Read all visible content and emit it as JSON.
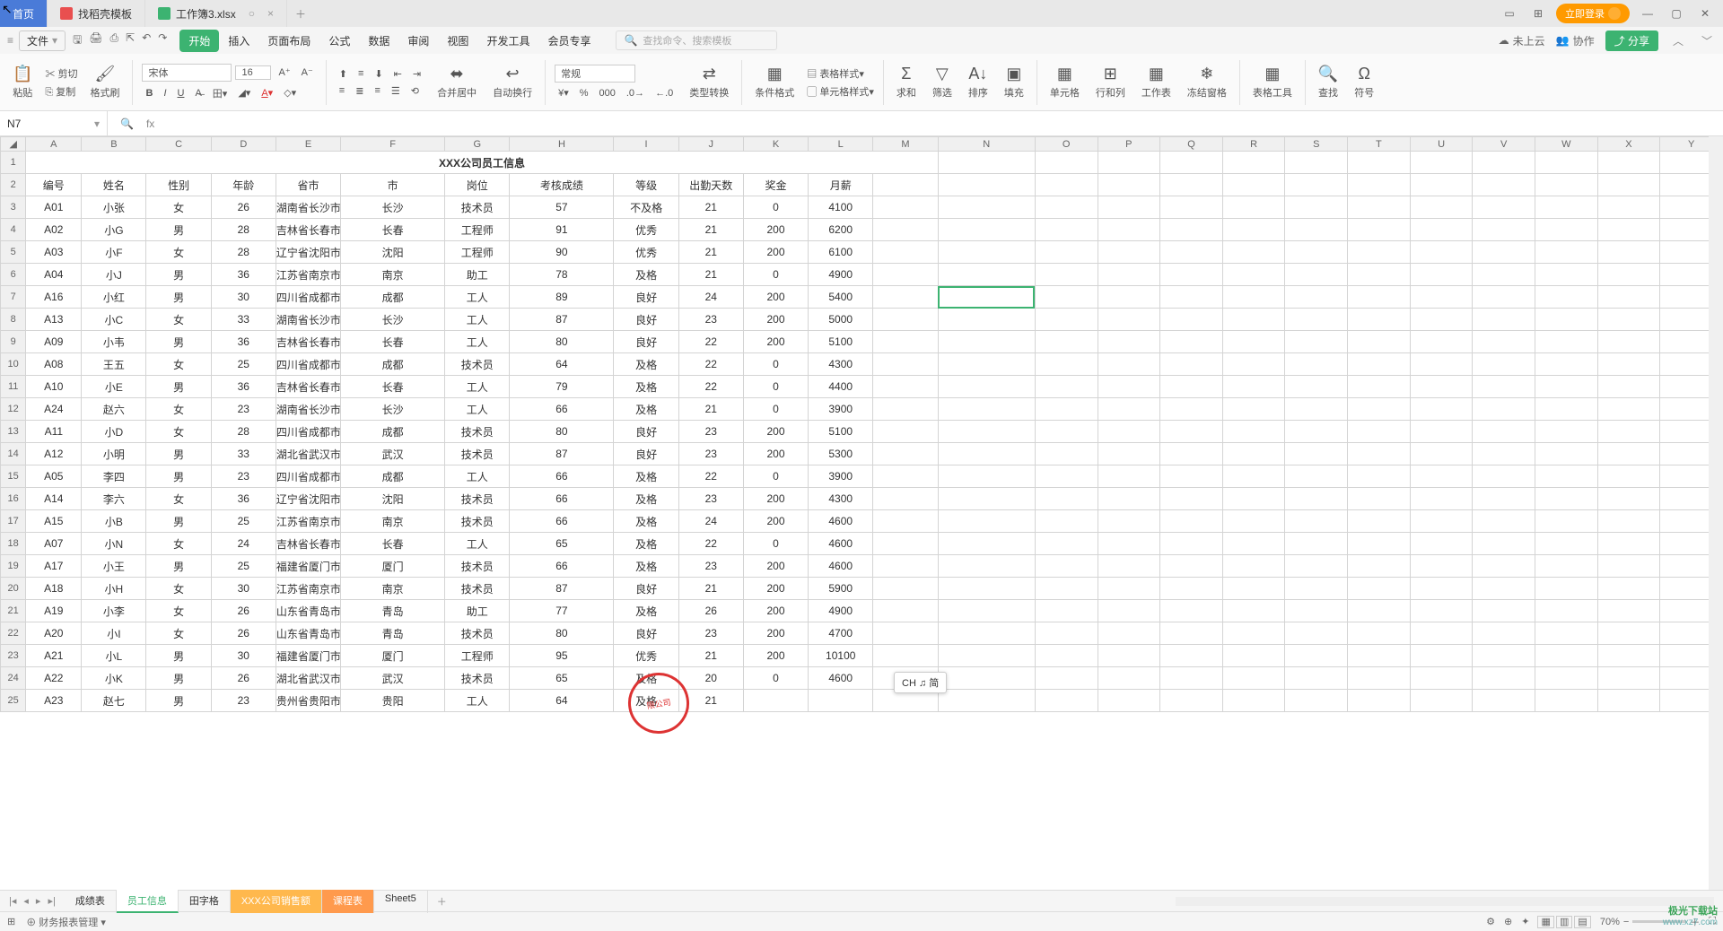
{
  "titlebar": {
    "home": "首页",
    "tab_template": "找稻壳模板",
    "tab_workbook": "工作簿3.xlsx",
    "login": "立即登录"
  },
  "menubar": {
    "file": "文件",
    "tabs": [
      "开始",
      "插入",
      "页面布局",
      "公式",
      "数据",
      "审阅",
      "视图",
      "开发工具",
      "会员专享"
    ],
    "search_placeholder": "查找命令、搜索模板",
    "cloud": "未上云",
    "collab": "协作",
    "share": "分享"
  },
  "ribbon": {
    "paste": "粘贴",
    "cut": "剪切",
    "copy": "复制",
    "format_painter": "格式刷",
    "font_name": "宋体",
    "font_size": "16",
    "merge_center": "合并居中",
    "wrap": "自动换行",
    "number_format": "常规",
    "type_convert": "类型转换",
    "cond_fmt": "条件格式",
    "table_style": "表格样式",
    "cell_style": "单元格样式",
    "sum": "求和",
    "filter": "筛选",
    "sort": "排序",
    "fill": "填充",
    "cells": "单元格",
    "rowscols": "行和列",
    "worksheet": "工作表",
    "freeze": "冻结窗格",
    "table_tools": "表格工具",
    "find": "查找",
    "symbol": "符号"
  },
  "formula": {
    "cell_ref": "N7",
    "fx": "fx"
  },
  "sheet": {
    "title": "XXX公司员工信息",
    "columns": [
      "A",
      "B",
      "C",
      "D",
      "E",
      "F",
      "G",
      "H",
      "I",
      "J",
      "K",
      "L",
      "M",
      "N",
      "O",
      "P",
      "Q",
      "R",
      "S",
      "T",
      "U",
      "V",
      "W",
      "X",
      "Y"
    ],
    "headers": [
      "编号",
      "姓名",
      "性别",
      "年龄",
      "省市",
      "市",
      "岗位",
      "考核成绩",
      "等级",
      "出勤天数",
      "奖金",
      "月薪"
    ],
    "rows": [
      [
        "A01",
        "小张",
        "女",
        "26",
        "湖南省长沙市",
        "长沙",
        "技术员",
        "57",
        "不及格",
        "21",
        "0",
        "4100"
      ],
      [
        "A02",
        "小G",
        "男",
        "28",
        "吉林省长春市",
        "长春",
        "工程师",
        "91",
        "优秀",
        "21",
        "200",
        "6200"
      ],
      [
        "A03",
        "小F",
        "女",
        "28",
        "辽宁省沈阳市",
        "沈阳",
        "工程师",
        "90",
        "优秀",
        "21",
        "200",
        "6100"
      ],
      [
        "A04",
        "小J",
        "男",
        "36",
        "江苏省南京市",
        "南京",
        "助工",
        "78",
        "及格",
        "21",
        "0",
        "4900"
      ],
      [
        "A16",
        "小红",
        "男",
        "30",
        "四川省成都市",
        "成都",
        "工人",
        "89",
        "良好",
        "24",
        "200",
        "5400"
      ],
      [
        "A13",
        "小C",
        "女",
        "33",
        "湖南省长沙市",
        "长沙",
        "工人",
        "87",
        "良好",
        "23",
        "200",
        "5000"
      ],
      [
        "A09",
        "小韦",
        "男",
        "36",
        "吉林省长春市",
        "长春",
        "工人",
        "80",
        "良好",
        "22",
        "200",
        "5100"
      ],
      [
        "A08",
        "王五",
        "女",
        "25",
        "四川省成都市",
        "成都",
        "技术员",
        "64",
        "及格",
        "22",
        "0",
        "4300"
      ],
      [
        "A10",
        "小E",
        "男",
        "36",
        "吉林省长春市",
        "长春",
        "工人",
        "79",
        "及格",
        "22",
        "0",
        "4400"
      ],
      [
        "A24",
        "赵六",
        "女",
        "23",
        "湖南省长沙市",
        "长沙",
        "工人",
        "66",
        "及格",
        "21",
        "0",
        "3900"
      ],
      [
        "A11",
        "小D",
        "女",
        "28",
        "四川省成都市",
        "成都",
        "技术员",
        "80",
        "良好",
        "23",
        "200",
        "5100"
      ],
      [
        "A12",
        "小明",
        "男",
        "33",
        "湖北省武汉市",
        "武汉",
        "技术员",
        "87",
        "良好",
        "23",
        "200",
        "5300"
      ],
      [
        "A05",
        "李四",
        "男",
        "23",
        "四川省成都市",
        "成都",
        "工人",
        "66",
        "及格",
        "22",
        "0",
        "3900"
      ],
      [
        "A14",
        "李六",
        "女",
        "36",
        "辽宁省沈阳市",
        "沈阳",
        "技术员",
        "66",
        "及格",
        "23",
        "200",
        "4300"
      ],
      [
        "A15",
        "小B",
        "男",
        "25",
        "江苏省南京市",
        "南京",
        "技术员",
        "66",
        "及格",
        "24",
        "200",
        "4600"
      ],
      [
        "A07",
        "小N",
        "女",
        "24",
        "吉林省长春市",
        "长春",
        "工人",
        "65",
        "及格",
        "22",
        "0",
        "4600"
      ],
      [
        "A17",
        "小王",
        "男",
        "25",
        "福建省厦门市",
        "厦门",
        "技术员",
        "66",
        "及格",
        "23",
        "200",
        "4600"
      ],
      [
        "A18",
        "小H",
        "女",
        "30",
        "江苏省南京市",
        "南京",
        "技术员",
        "87",
        "良好",
        "21",
        "200",
        "5900"
      ],
      [
        "A19",
        "小李",
        "女",
        "26",
        "山东省青岛市",
        "青岛",
        "助工",
        "77",
        "及格",
        "26",
        "200",
        "4900"
      ],
      [
        "A20",
        "小I",
        "女",
        "26",
        "山东省青岛市",
        "青岛",
        "技术员",
        "80",
        "良好",
        "23",
        "200",
        "4700"
      ],
      [
        "A21",
        "小L",
        "男",
        "30",
        "福建省厦门市",
        "厦门",
        "工程师",
        "95",
        "优秀",
        "21",
        "200",
        "10100"
      ],
      [
        "A22",
        "小K",
        "男",
        "26",
        "湖北省武汉市",
        "武汉",
        "技术员",
        "65",
        "及格",
        "20",
        "0",
        "4600"
      ],
      [
        "A23",
        "赵七",
        "男",
        "23",
        "贵州省贵阳市",
        "贵阳",
        "工人",
        "64",
        "及格",
        "21",
        "",
        "",
        ""
      ]
    ],
    "selected_cell": "N7",
    "stamp_text": "限公司",
    "ime_text": "CH ♫ 简"
  },
  "sheettabs": {
    "tabs": [
      {
        "label": "成绩表",
        "style": ""
      },
      {
        "label": "员工信息",
        "style": "active"
      },
      {
        "label": "田字格",
        "style": ""
      },
      {
        "label": "XXX公司销售额",
        "style": "orange"
      },
      {
        "label": "课程表",
        "style": "orange2"
      },
      {
        "label": "Sheet5",
        "style": ""
      }
    ]
  },
  "statusbar": {
    "mode_icon": "⊞",
    "finance": "财务报表管理",
    "zoom": "70%"
  },
  "watermark": {
    "l1": "极光下载站",
    "l2": "www.xz7.com"
  }
}
